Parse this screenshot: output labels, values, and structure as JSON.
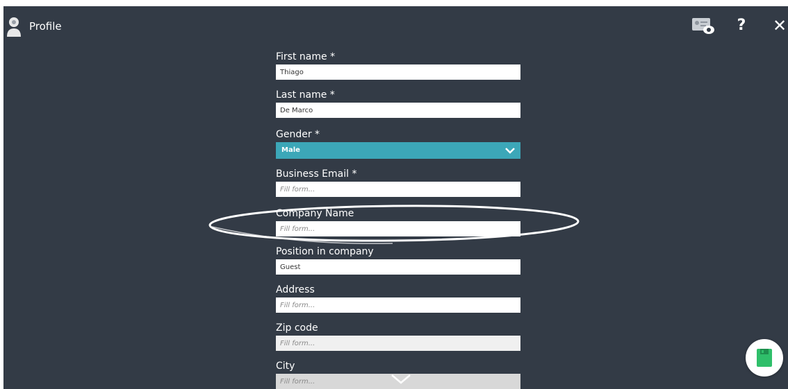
{
  "header": {
    "title": "Profile",
    "help_label": "?",
    "close_label": "✕"
  },
  "form": {
    "fields": [
      {
        "label": "First name *",
        "value": "Thiago",
        "placeholder": "Fill form..."
      },
      {
        "label": "Last name *",
        "value": "De Marco",
        "placeholder": "Fill form..."
      },
      {
        "label": "Gender *",
        "value": "Male"
      },
      {
        "label": "Business Email *",
        "value": "",
        "placeholder": "Fill form..."
      },
      {
        "label": "Company Name",
        "value": "",
        "placeholder": "Fill form..."
      },
      {
        "label": "Position in company",
        "value": "Guest",
        "placeholder": "Fill form..."
      },
      {
        "label": "Address",
        "value": "",
        "placeholder": "Fill form..."
      },
      {
        "label": "Zip code",
        "value": "",
        "placeholder": "Fill form..."
      },
      {
        "label": "City",
        "value": "",
        "placeholder": "Fill form..."
      }
    ]
  },
  "icons": {
    "avatar": "user-avatar-icon",
    "id_card": "id-card-eye-icon",
    "select": "chevron-down-icon",
    "scroll": "chevron-down-icon",
    "save": "save-icon"
  },
  "colors": {
    "background": "#333b46",
    "select_accent": "#3ca7b8",
    "save_accent": "#2fbf6a"
  }
}
